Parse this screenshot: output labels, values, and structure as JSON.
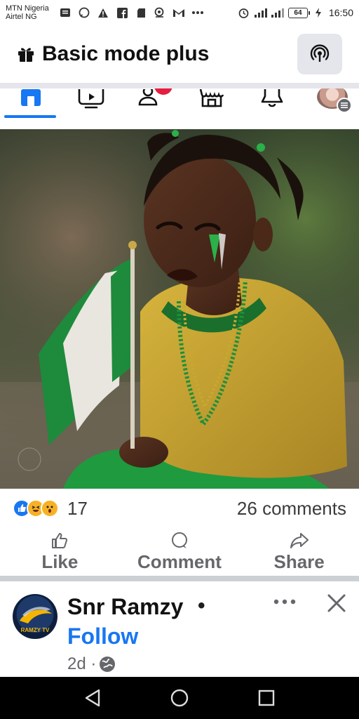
{
  "status_bar": {
    "carrier_1": "MTN Nigeria",
    "carrier_2": "Airtel NG",
    "battery": "64",
    "time": "16:50",
    "icons": [
      "message-icon",
      "whatsapp-icon",
      "warning-icon",
      "facebook-icon",
      "sd-card-icon",
      "snapchat-icon",
      "gmail-icon",
      "more-dots-icon",
      "alarm-icon",
      "signal-icon",
      "signal-icon",
      "battery-icon",
      "charging-icon"
    ]
  },
  "header": {
    "title": "Basic mode plus",
    "title_icon": "gift-icon",
    "action_icon": "broadcast-icon"
  },
  "tabs": [
    {
      "name": "home",
      "icon": "home-icon",
      "active": true
    },
    {
      "name": "video",
      "icon": "video-icon",
      "active": false
    },
    {
      "name": "friends",
      "icon": "friends-icon",
      "active": false
    },
    {
      "name": "marketplace",
      "icon": "marketplace-icon",
      "active": false
    },
    {
      "name": "notifications",
      "icon": "bell-icon",
      "active": false
    },
    {
      "name": "profile",
      "icon": "avatar",
      "active": false
    }
  ],
  "post": {
    "reactions": [
      "like",
      "haha",
      "wow"
    ],
    "reaction_count": "17",
    "comments": "26 comments",
    "actions": {
      "like": "Like",
      "comment": "Comment",
      "share": "Share"
    }
  },
  "next_post": {
    "author": "Snr Ramzy",
    "separator": "•",
    "follow": "Follow",
    "timestamp": "2d ·",
    "avatar_label": "RAMZY TV"
  },
  "colors": {
    "accent": "#1877f2",
    "notification": "#e41e3f",
    "flag_green": "#1e8a3c"
  }
}
